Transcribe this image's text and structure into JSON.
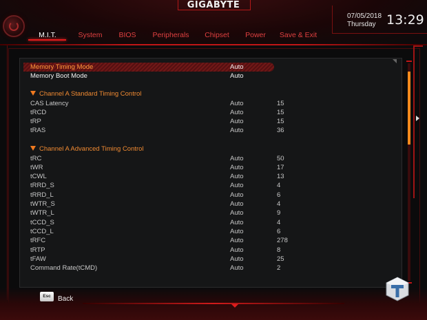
{
  "header": {
    "brand": "GIGABYTE",
    "date": "07/05/2018",
    "weekday": "Thursday",
    "time": "13:29"
  },
  "tabs": [
    {
      "label": "M.I.T.",
      "active": true
    },
    {
      "label": "System"
    },
    {
      "label": "BIOS"
    },
    {
      "label": "Peripherals"
    },
    {
      "label": "Chipset"
    },
    {
      "label": "Power"
    },
    {
      "label": "Save & Exit"
    }
  ],
  "top_items": [
    {
      "label": "Memory Timing Mode",
      "mode": "Auto"
    },
    {
      "label": "Memory Boot Mode",
      "mode": "Auto"
    }
  ],
  "section_standard": {
    "title": "Channel A Standard Timing Control",
    "rows": [
      {
        "label": "CAS Latency",
        "mode": "Auto",
        "value": "15"
      },
      {
        "label": "tRCD",
        "mode": "Auto",
        "value": "15"
      },
      {
        "label": "tRP",
        "mode": "Auto",
        "value": "15"
      },
      {
        "label": "tRAS",
        "mode": "Auto",
        "value": "36"
      }
    ]
  },
  "section_advanced": {
    "title": "Channel A Advanced Timing Control",
    "rows": [
      {
        "label": "tRC",
        "mode": "Auto",
        "value": "50"
      },
      {
        "label": "tWR",
        "mode": "Auto",
        "value": "17"
      },
      {
        "label": "tCWL",
        "mode": "Auto",
        "value": "13"
      },
      {
        "label": "tRRD_S",
        "mode": "Auto",
        "value": "4"
      },
      {
        "label": "tRRD_L",
        "mode": "Auto",
        "value": "6"
      },
      {
        "label": "tWTR_S",
        "mode": "Auto",
        "value": "4"
      },
      {
        "label": "tWTR_L",
        "mode": "Auto",
        "value": "9"
      },
      {
        "label": "tCCD_S",
        "mode": "Auto",
        "value": "4"
      },
      {
        "label": "tCCD_L",
        "mode": "Auto",
        "value": "6"
      },
      {
        "label": "tRFC",
        "mode": "Auto",
        "value": "278"
      },
      {
        "label": "tRTP",
        "mode": "Auto",
        "value": "8"
      },
      {
        "label": "tFAW",
        "mode": "Auto",
        "value": "25"
      },
      {
        "label": "Command Rate(tCMD)",
        "mode": "Auto",
        "value": "2"
      }
    ]
  },
  "footer": {
    "esc_key": "Esc",
    "back_label": "Back"
  },
  "icons": {
    "logo": "gigabyte-disc-icon",
    "watermark": "tweaktown-logo-icon"
  },
  "colors": {
    "accent_red": "#e21c1c",
    "section_orange": "#f08a32",
    "selected_text": "#ff9a3c",
    "scroll_thumb": "#ff8a1c"
  }
}
